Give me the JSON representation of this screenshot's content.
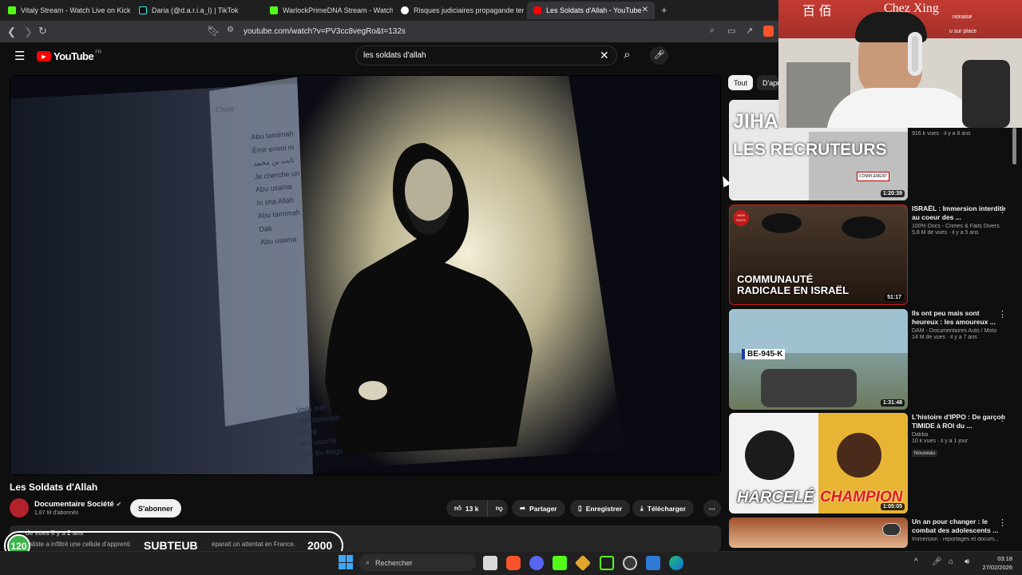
{
  "tabs": [
    {
      "label": "Vitaly Stream - Watch Live on Kick",
      "icon": "kick-icon"
    },
    {
      "label": "Daria (@d.a.r.i.a_l) | TikTok",
      "icon": "tiktok-icon"
    },
    {
      "label": "WarlockPrimeDNA Stream - Watch Li",
      "icon": "kick-icon"
    },
    {
      "label": "Risques judiciaires propagande terro",
      "icon": "web-icon"
    },
    {
      "label": "Les Soldats d'Allah - YouTube",
      "icon": "youtube-icon",
      "close": "✕"
    }
  ],
  "new_tab": "+",
  "address": {
    "url": "youtube.com/watch?v=PV3cc8vegRo&t=132s"
  },
  "youtube": {
    "logo_text": "YouTube",
    "region": "FR",
    "search_value": "les soldats d'allah"
  },
  "chips": [
    "Tout",
    "D'apr"
  ],
  "video": {
    "chat_close": "Close",
    "chat_lines": [
      "Abu tamimah",
      "Émir envoi m",
      "ثابت بن محمد",
      "Je cherche un",
      "Abu usama",
      "In sha Allah",
      "Abu tamimah",
      "Dak",
      "Abu usama",
      "Voila mdr",
      "Abu tamimah",
      "Le bg",
      "Abu usama",
      "Ces toi lbogo"
    ]
  },
  "title": "Les Soldats d'Allah",
  "channel": {
    "name": "Documentaire Société",
    "subs": "1,87 M d'abonnés",
    "subscribe": "S'abonner"
  },
  "actions": {
    "likes": "13 k",
    "share": "Partager",
    "save": "Enregistrer",
    "download": "Télécharger",
    "more": "···"
  },
  "description": {
    "stats": "de vues  il y a 2 ans",
    "text_left": "naliste a infiltré une cellule d'apprenti",
    "text_right": "éparait un attentat en France."
  },
  "overlay": {
    "left_count": "120",
    "label": "SUBTEUB",
    "goal": "2000"
  },
  "recommendations": [
    {
      "thumb_text": [
        "JIHA",
        "LES RECRUTEURS"
      ],
      "thumb_badge": "COMPLEMENT",
      "duration": "1:20:39",
      "title": "",
      "channel": "",
      "stats": "916 k vues · il y a 8 ans"
    },
    {
      "thumb_text": [
        "COMMUNAUTÉ",
        "RADICALE EN ISRAËL"
      ],
      "thumb_badge": "100% DOCS",
      "duration": "51:17",
      "title": "ISRAËL : Immersion interdite au coeur des ...",
      "channel": "100% Docs - Crimes & Faits Divers",
      "stats": "5,8 M de vues · il y a 5 ans"
    },
    {
      "thumb_text": [
        "BE-945-K"
      ],
      "thumb_badge": "",
      "duration": "1:31:48",
      "title": "Ils ont peu mais sont heureux : les amoureux ...",
      "channel": "DAM - Documentaires Auto / Moto",
      "stats": "14 M de vues · il y a 7 ans"
    },
    {
      "thumb_text": [
        "HARCELÉ",
        "CHAMPION"
      ],
      "thumb_badge": "",
      "duration": "1:05:05",
      "title": "L'histoire d'IPPO : De garçon TIMIDE à ROI du ...",
      "channel": "Dakba",
      "stats": "10 k vues · il y a 1 jour",
      "badge": "Nouveau"
    },
    {
      "thumb_text": [],
      "thumb_badge": "",
      "duration": "",
      "title": "Un an pour changer : le combat des adolescents ...",
      "channel": "",
      "stats": "Immersion · reportages et docum..."
    }
  ],
  "webcam": {
    "sign": "Chez Xing",
    "sub1": "nonaise",
    "sub2": "u sur place",
    "glyphs": "百 佰"
  },
  "taskbar": {
    "search_placeholder": "Rechercher",
    "time": "03:18",
    "date": "27/02/2026"
  },
  "colors": {
    "yt_red": "#ff0000",
    "kick_green": "#53fc18",
    "bg": "#0f0f0f"
  }
}
